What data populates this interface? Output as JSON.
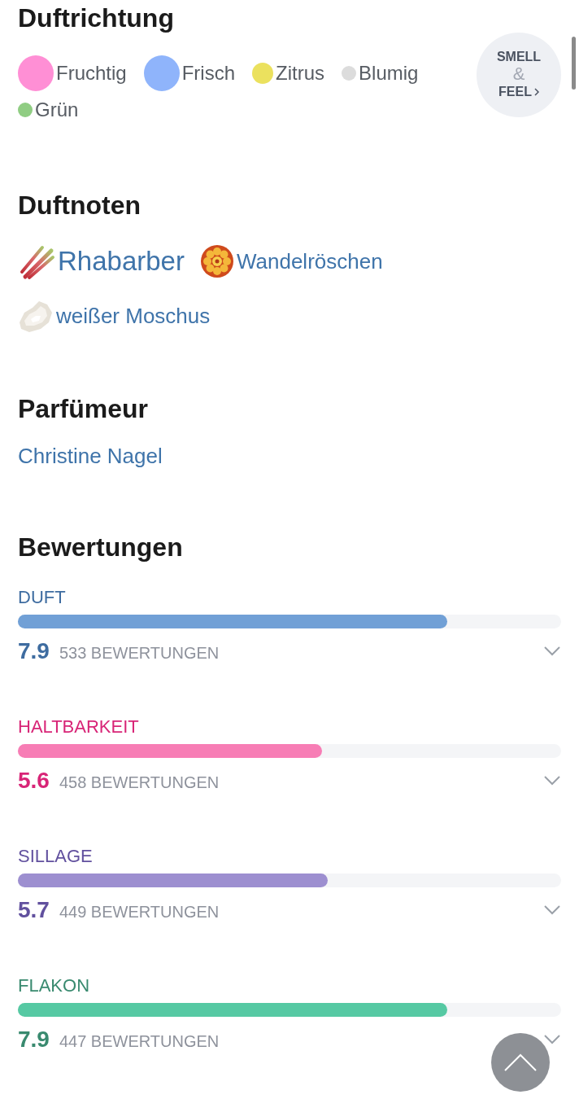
{
  "scent_direction": {
    "title": "Duftrichtung",
    "accords": [
      {
        "label": "Fruchtig",
        "color": "#ff8fd5",
        "kind": "large"
      },
      {
        "label": "Frisch",
        "color": "#8fb4fb",
        "kind": "large"
      },
      {
        "label": "Zitrus",
        "color": "#ebe15e",
        "kind": "medium"
      },
      {
        "label": "Blumig",
        "color": "#dcdcdc",
        "kind": "small"
      },
      {
        "label": "Grün",
        "color": "#90cd83",
        "kind": "small"
      }
    ]
  },
  "smell_feel_button": {
    "line_1": "SMELL",
    "ampersand": "&",
    "line_2": "FEEL"
  },
  "notes": {
    "title": "Duftnoten",
    "items": [
      {
        "label": "Rhabarber",
        "kind": "rhubarb",
        "highlighted": true
      },
      {
        "label": "Wandelröschen",
        "kind": "flower",
        "highlighted": false
      },
      {
        "label": "weißer Moschus",
        "kind": "musk",
        "highlighted": false
      }
    ]
  },
  "perfumer": {
    "title": "Parfümeur",
    "name": "Christine Nagel"
  },
  "ratings": {
    "title": "Bewertungen",
    "items": [
      {
        "label": "DUFT",
        "score": "7.9",
        "count": "533 BEWERTUNGEN",
        "level": 0.79,
        "color": "#71a0d6",
        "expanded": false
      },
      {
        "label": "HALTBARKEIT",
        "score": "5.6",
        "count": "458 BEWERTUNGEN",
        "level": 0.56,
        "color": "#f77db5",
        "expanded": false
      },
      {
        "label": "SILLAGE",
        "score": "5.7",
        "count": "449 BEWERTUNGEN",
        "level": 0.57,
        "color": "#9d8fd0",
        "expanded": false
      },
      {
        "label": "FLAKON",
        "score": "7.9",
        "count": "447 BEWERTUNGEN",
        "level": 0.79,
        "color": "#56c9a3",
        "expanded": false
      }
    ]
  }
}
